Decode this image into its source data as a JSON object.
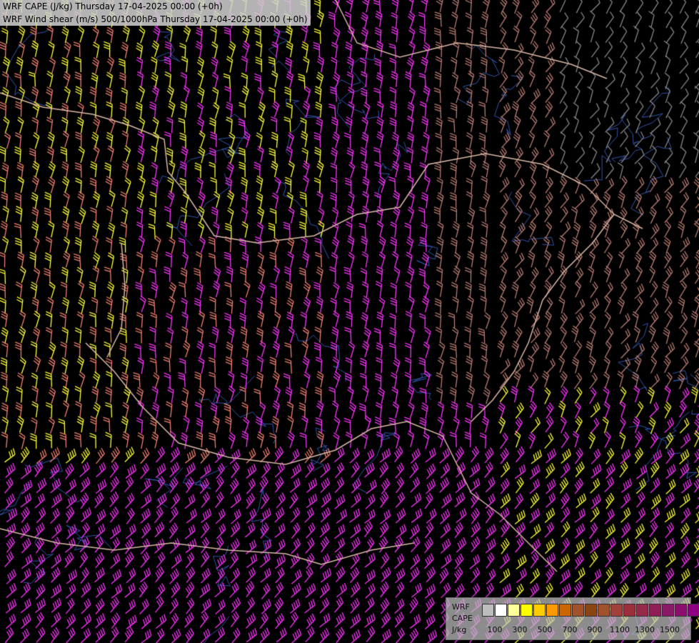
{
  "header": {
    "line1": "WRF CAPE (J/kg) Thursday 17-04-2025 00:00 (+0h)",
    "line2": "WRF Wind shear (m/s) 500/1000hPa Thursday 17-04-2025 00:00 (+0h)"
  },
  "legend": {
    "name_line1": "WRF",
    "name_line2": "CAPE",
    "unit": "J/kg",
    "colors": [
      "#bdbdbd",
      "#ffffff",
      "#ffff99",
      "#ffff00",
      "#ffcc00",
      "#ff9900",
      "#cc6600",
      "#a0522d",
      "#8b4513",
      "#a0522d",
      "#a0413c",
      "#9c2f3c",
      "#962a4a",
      "#8e1e55",
      "#8b1a66",
      "#8c0f70",
      "#8f0080"
    ],
    "ticks": [
      "100",
      "300",
      "500",
      "700",
      "900",
      "1100",
      "1300",
      "1500"
    ]
  },
  "barb_colors": {
    "yellow": "#ffff33",
    "magenta": "#ff33ff",
    "salmon": "#f08070",
    "brown": "#b87c72",
    "gray": "#888888"
  },
  "map_colors": {
    "border": "#d9b8a8",
    "river": "#3355aa"
  }
}
